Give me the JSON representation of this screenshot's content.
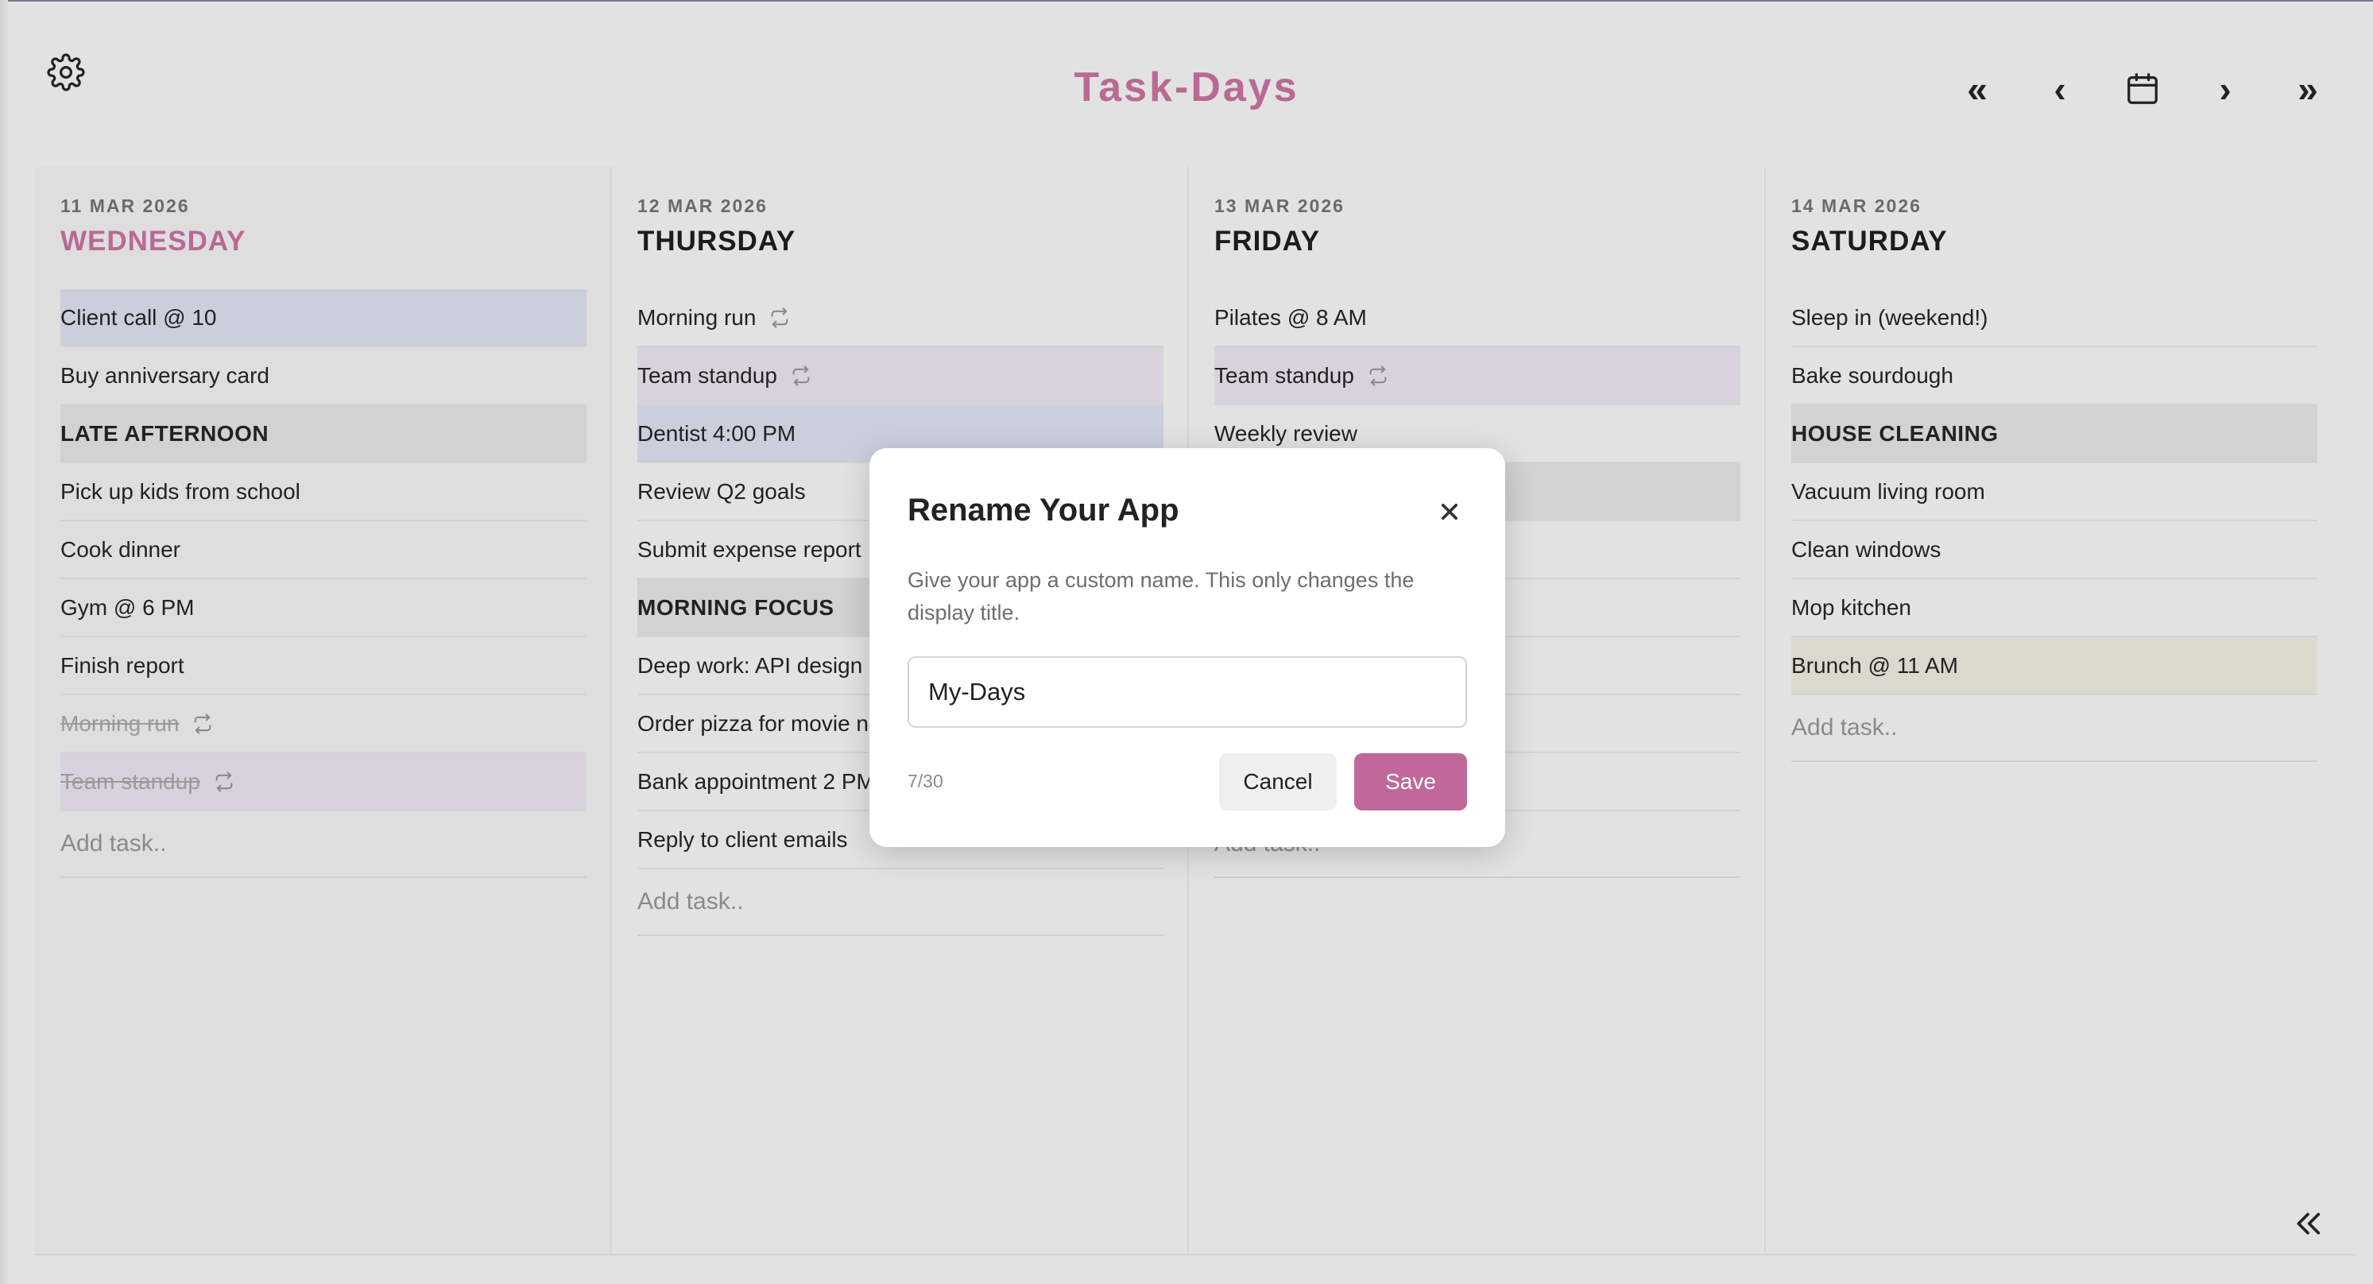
{
  "app": {
    "title": "Task-Days"
  },
  "header": {
    "settings_icon": "gear-icon",
    "nav": {
      "first": "«",
      "prev": "‹",
      "calendar_icon": "calendar-icon",
      "next": "›",
      "last": "»"
    }
  },
  "days": [
    {
      "date": "11 MAR 2026",
      "name": "WEDNESDAY",
      "today": true,
      "tasks": [
        {
          "text": "Client call @ 10",
          "bg": "#cbcfdc"
        },
        {
          "text": "Buy anniversary card"
        },
        {
          "text": "LATE AFTERNOON",
          "header": true,
          "bg": "#d2d2d2"
        },
        {
          "text": "Pick up kids from school"
        },
        {
          "text": "Cook dinner"
        },
        {
          "text": "Gym @ 6 PM"
        },
        {
          "text": "Finish report"
        },
        {
          "text": "Morning run",
          "done": true,
          "repeat": true
        },
        {
          "text": "Team standup",
          "done": true,
          "repeat": true,
          "bg": "#d9d2de"
        }
      ],
      "add_placeholder": "Add task.."
    },
    {
      "date": "12 MAR 2026",
      "name": "THURSDAY",
      "today": false,
      "tasks": [
        {
          "text": "Morning run",
          "repeat": true
        },
        {
          "text": "Team standup",
          "repeat": true,
          "bg": "#d9d2de"
        },
        {
          "text": "Dentist 4:00 PM",
          "bg": "#cbcfdc"
        },
        {
          "text": "Review Q2 goals"
        },
        {
          "text": "Submit expense report"
        },
        {
          "text": "MORNING FOCUS",
          "header": true,
          "bg": "#d2d2d2"
        },
        {
          "text": "Deep work: API design"
        },
        {
          "text": "Order pizza for movie n"
        },
        {
          "text": "Bank appointment 2 PM"
        },
        {
          "text": "Reply to client emails"
        }
      ],
      "add_placeholder": "Add task.."
    },
    {
      "date": "13 MAR 2026",
      "name": "FRIDAY",
      "today": false,
      "tasks": [
        {
          "text": "Pilates @ 8 AM"
        },
        {
          "text": "Team standup",
          "repeat": true,
          "bg": "#d9d2de"
        },
        {
          "text": "Weekly review"
        },
        {
          "text": "",
          "header": true,
          "bg": "#d2d2d2"
        },
        {
          "text": ""
        },
        {
          "text": ""
        },
        {
          "text": ""
        },
        {
          "text": ""
        },
        {
          "text": ""
        }
      ],
      "add_placeholder": "Add task.."
    },
    {
      "date": "14 MAR 2026",
      "name": "SATURDAY",
      "today": false,
      "tasks": [
        {
          "text": "Sleep in (weekend!)"
        },
        {
          "text": "Bake sourdough"
        },
        {
          "text": "HOUSE CLEANING",
          "header": true,
          "bg": "#d2d2d2"
        },
        {
          "text": "Vacuum living room"
        },
        {
          "text": "Clean windows"
        },
        {
          "text": "Mop kitchen"
        },
        {
          "text": "Brunch @ 11 AM",
          "bg": "#dcd8ce"
        }
      ],
      "add_placeholder": "Add task.."
    }
  ],
  "modal": {
    "title": "Rename Your App",
    "description": "Give your app a custom name. This only changes the display title.",
    "input_value": "My-Days",
    "char_count": "7/30",
    "cancel_label": "Cancel",
    "save_label": "Save",
    "close_icon": "close-icon"
  },
  "footer": {
    "collapse_icon": "double-chevron-left-icon"
  },
  "colors": {
    "accent": "#b96993",
    "save": "#c0689a",
    "background": "#e2e2e2"
  }
}
